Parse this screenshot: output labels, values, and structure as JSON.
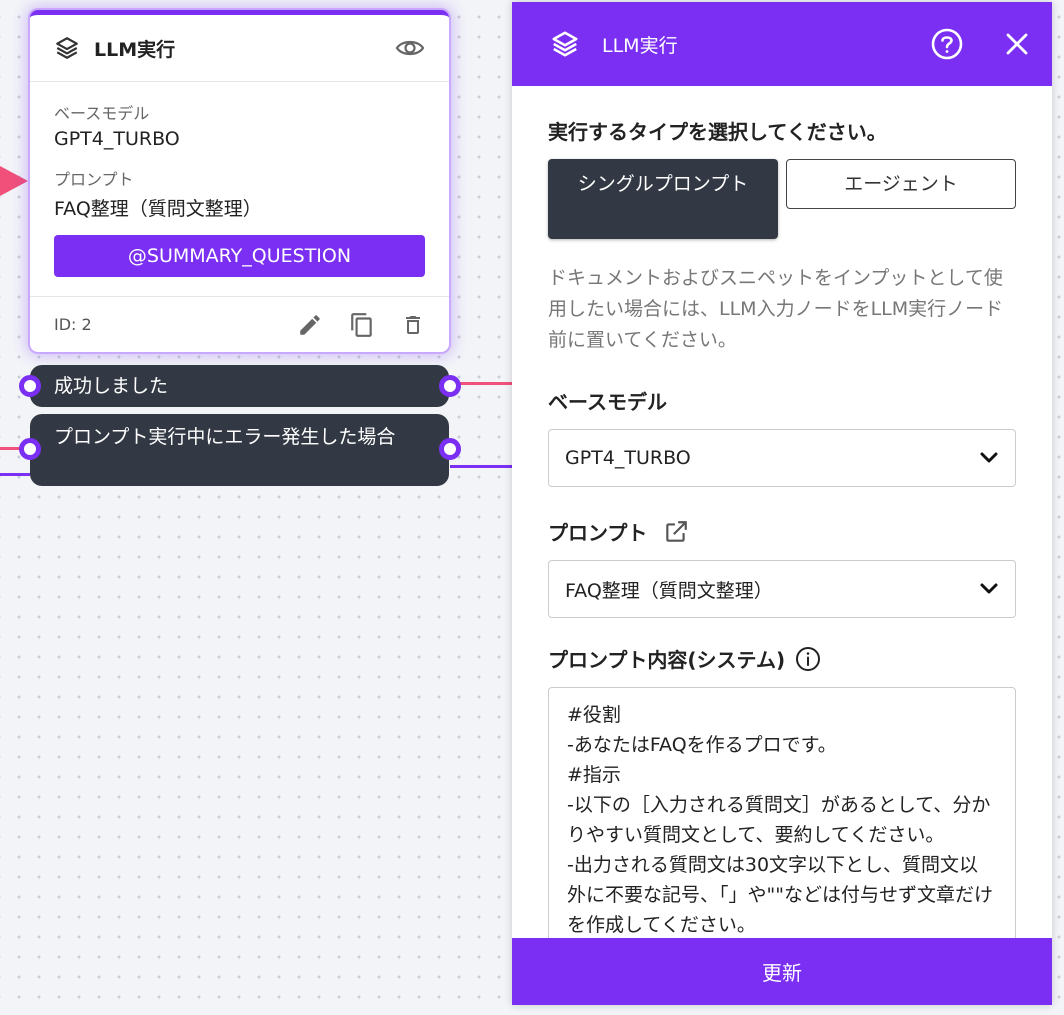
{
  "node": {
    "title": "LLM実行",
    "base_model_label": "ベースモデル",
    "base_model_value": "GPT4_TURBO",
    "prompt_label": "プロンプト",
    "prompt_value": "FAQ整理（質問文整理）",
    "variable_tag": "@SUMMARY_QUESTION",
    "id_text": "ID: 2",
    "icons": {
      "layers": "layers-icon",
      "preview": "eye-icon",
      "edit": "pencil-icon",
      "copy": "copy-icon",
      "delete": "trash-icon"
    }
  },
  "outputs": {
    "success_label": "成功しました",
    "error_label": "プロンプト実行中にエラー発生した場合"
  },
  "panel": {
    "title": "LLM実行",
    "help_icon": "help-circle-icon",
    "close_icon": "close-icon",
    "type_question": "実行するタイプを選択してください。",
    "type_options": {
      "single": "シングルプロンプト",
      "agent": "エージェント"
    },
    "selected_type": "single",
    "hint_text": "ドキュメントおよびスニペットをインプットとして使用したい場合には、LLM入力ノードをLLM実行ノード前に置いてください。",
    "base_model_label": "ベースモデル",
    "base_model_value": "GPT4_TURBO",
    "prompt_label": "プロンプト",
    "prompt_value": "FAQ整理（質問文整理）",
    "prompt_content_label": "プロンプト内容(システム)",
    "prompt_content": "#役割\n-あなたはFAQを作るプロです。\n#指示\n-以下の［入力される質問文］があるとして、分かりやすい質問文として、要約してください。\n-出力される質問文は30文字以下とし、質問文以外に不要な記号、「」や\"\"などは付与せず文章だけを作成してください。",
    "update_button": "更新"
  },
  "colors": {
    "accent": "#7b2ff2",
    "dark_pill": "#333944",
    "edge_pink": "#f0507a"
  }
}
